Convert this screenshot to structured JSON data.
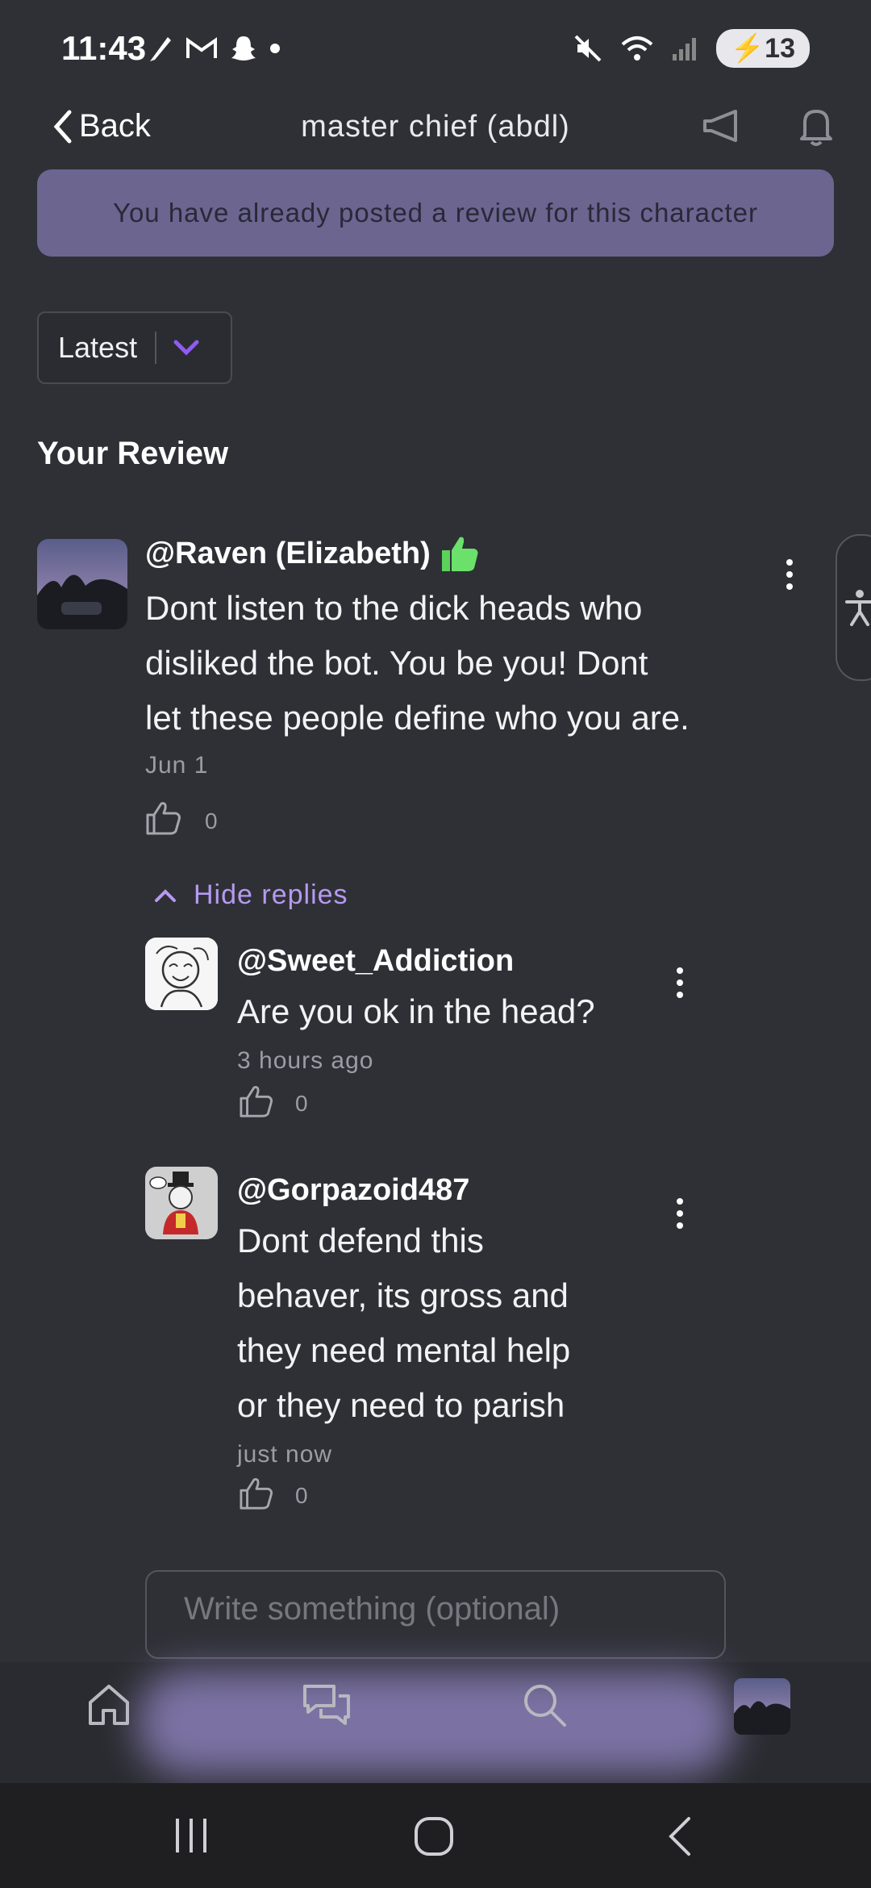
{
  "status_bar": {
    "time": "11:43",
    "battery": "13"
  },
  "header": {
    "back_label": "Back",
    "title": "master chief (abdl)"
  },
  "banner": {
    "text": "You have already posted a review for this character"
  },
  "sort": {
    "selected": "Latest"
  },
  "section_title": "Your Review",
  "review": {
    "handle": "@Raven (Elizabeth)",
    "text_lines": [
      "Dont listen to the dick heads who",
      "disliked the bot. You be you! Dont",
      "let these people define who you are."
    ],
    "date": "Jun 1",
    "likes": "0",
    "hide_replies_label": "Hide replies"
  },
  "replies": [
    {
      "handle": "@Sweet_Addiction",
      "text_lines": [
        "Are you ok in the head?"
      ],
      "time": "3 hours ago",
      "likes": "0"
    },
    {
      "handle": "@Gorpazoid487",
      "text_lines": [
        "Dont defend this",
        "behaver, its gross and",
        "they need mental help",
        "or they need to parish"
      ],
      "time": "just now",
      "likes": "0"
    }
  ],
  "reply_input": {
    "placeholder": "Write something (optional)"
  },
  "colors": {
    "background": "#2f3036",
    "banner": "#6b6590",
    "accent": "#b59af0",
    "nav_glow": "#8a7fb8"
  },
  "icons": {
    "back": "chevron-left-icon",
    "announce": "megaphone-icon",
    "notifications": "bell-icon",
    "sort_toggle": "chevron-down-icon",
    "like": "thumbs-up-icon",
    "more": "more-vertical-icon",
    "nav_home": "home-icon",
    "nav_chat": "chat-icon",
    "nav_search": "search-icon",
    "accessibility": "accessibility-icon"
  }
}
